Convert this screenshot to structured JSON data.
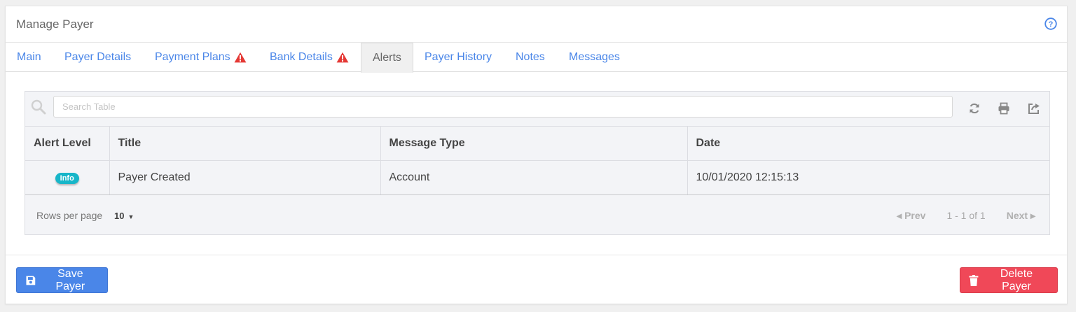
{
  "header": {
    "title": "Manage Payer"
  },
  "tabs": [
    {
      "label": "Main",
      "warning": false
    },
    {
      "label": "Payer Details",
      "warning": false
    },
    {
      "label": "Payment Plans",
      "warning": true
    },
    {
      "label": "Bank Details",
      "warning": true
    },
    {
      "label": "Alerts",
      "warning": false,
      "active": true
    },
    {
      "label": "Payer History",
      "warning": false
    },
    {
      "label": "Notes",
      "warning": false
    },
    {
      "label": "Messages",
      "warning": false
    }
  ],
  "search": {
    "placeholder": "Search Table",
    "value": ""
  },
  "table": {
    "columns": [
      "Alert Level",
      "Title",
      "Message Type",
      "Date"
    ],
    "rows": [
      {
        "alert_level": "Info",
        "title": "Payer Created",
        "message_type": "Account",
        "date": "10/01/2020 12:15:13"
      }
    ]
  },
  "pagination": {
    "rows_label": "Rows per page",
    "rows_value": "10",
    "prev": "Prev",
    "range": "1 - 1 of 1",
    "next": "Next"
  },
  "actions": {
    "save": "Save Payer",
    "delete": "Delete Payer"
  },
  "colors": {
    "accent": "#4a86e8",
    "danger": "#f04858",
    "info": "#17b6c9",
    "warning": "#e53935"
  }
}
